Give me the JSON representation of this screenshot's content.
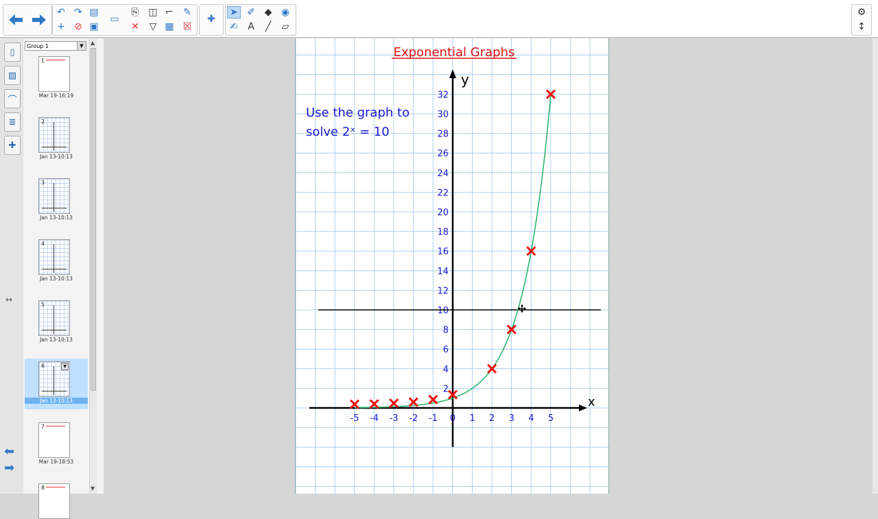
{
  "toolbar": {
    "nav": [
      {
        "icon": "arrow-left-icon"
      },
      {
        "icon": "arrow-right-icon"
      }
    ],
    "tools": [
      {
        "icon": "undo-icon",
        "glyph": "↶"
      },
      {
        "icon": "redo-icon",
        "glyph": "↷"
      },
      {
        "icon": "open-folder-icon",
        "glyph": "▤"
      },
      {
        "icon": "add-page-icon",
        "glyph": "+"
      },
      {
        "icon": "delete-page-icon",
        "glyph": "⊘"
      },
      {
        "icon": "save-icon",
        "glyph": "▣"
      },
      {
        "icon": "display-icon",
        "glyph": "▭"
      },
      {
        "icon": "paste-icon",
        "glyph": "⎘"
      },
      {
        "icon": "screen-capture-icon",
        "glyph": "◫"
      },
      {
        "icon": "screen-shade-icon",
        "glyph": "⌐"
      },
      {
        "icon": "magic-pen-icon",
        "glyph": "✎"
      },
      {
        "icon": "delete-icon",
        "glyph": "✕"
      },
      {
        "icon": "show-hide-icon",
        "glyph": "▽"
      },
      {
        "icon": "table-icon",
        "glyph": "▦"
      },
      {
        "icon": "close-box-icon",
        "glyph": "☒"
      },
      {
        "icon": "addon-puzzle-icon",
        "glyph": "✚"
      },
      {
        "icon": "select-arrow-icon",
        "glyph": "➤"
      },
      {
        "icon": "pen-icon",
        "glyph": "✐"
      },
      {
        "icon": "eraser-icon",
        "glyph": "◆"
      },
      {
        "icon": "fill-icon",
        "glyph": "◉"
      },
      {
        "icon": "pens-icon",
        "glyph": "✍"
      },
      {
        "icon": "text-icon",
        "glyph": "A"
      },
      {
        "icon": "line-icon",
        "glyph": "╱"
      },
      {
        "icon": "eraser-alt-icon",
        "glyph": "▱"
      }
    ],
    "right": [
      {
        "icon": "settings-gear-icon",
        "glyph": "⚙"
      },
      {
        "icon": "move-toolbar-icon",
        "glyph": "↕"
      }
    ]
  },
  "sidebar_tabs": [
    {
      "icon": "page-sorter-icon",
      "glyph": "▯"
    },
    {
      "icon": "gallery-icon",
      "glyph": "▨"
    },
    {
      "icon": "attachments-icon",
      "glyph": "⌒"
    },
    {
      "icon": "properties-icon",
      "glyph": "≣"
    },
    {
      "icon": "addons-icon",
      "glyph": "✚"
    }
  ],
  "sorter": {
    "group_label": "Group 1",
    "pages": [
      {
        "num": "1",
        "date": "Mar 19-16:19",
        "grid": false,
        "selected": false
      },
      {
        "num": "2",
        "date": "Jan 13-10:13",
        "grid": true,
        "selected": false
      },
      {
        "num": "3",
        "date": "Jan 13-10:13",
        "grid": true,
        "selected": false
      },
      {
        "num": "4",
        "date": "Jan 13-10:13",
        "grid": true,
        "selected": false
      },
      {
        "num": "5",
        "date": "Jan 13-10:13",
        "grid": true,
        "selected": false
      },
      {
        "num": "6",
        "date": "Jan 13-10:13",
        "grid": true,
        "selected": true
      },
      {
        "num": "7",
        "date": "Mar 19-18:53",
        "grid": false,
        "selected": false
      },
      {
        "num": "8",
        "date": "",
        "grid": false,
        "selected": false
      }
    ]
  },
  "colors": {
    "grid": "#9cc3ea",
    "title": "#e01010",
    "text": "#1a1ad0",
    "curve": "#2db56e",
    "marker": "#ee1111",
    "axis": "#000000"
  },
  "whiteboard": {
    "title": "Exponential Graphs",
    "instruction_line1": "Use the graph to",
    "instruction_line2": "solve 2ˣ = 10",
    "x_axis_label": "x",
    "y_axis_label": "y"
  },
  "chart_data": {
    "type": "line",
    "title": "Exponential Graphs",
    "xlabel": "x",
    "ylabel": "y",
    "xlim": [
      -5,
      5
    ],
    "ylim": [
      0,
      32
    ],
    "x_ticks": [
      "-5",
      "-4",
      "-3",
      "-2",
      "-1",
      "0",
      "1",
      "2",
      "3",
      "4",
      "5"
    ],
    "y_ticks": [
      "2",
      "4",
      "6",
      "8",
      "10",
      "12",
      "14",
      "16",
      "18",
      "20",
      "22",
      "24",
      "26",
      "28",
      "30",
      "32"
    ],
    "series": [
      {
        "kind": "curve",
        "x": [
          -5,
          -4,
          -3,
          -2,
          -1,
          0,
          1,
          2,
          3,
          4,
          5
        ],
        "values": [
          0.03,
          0.06,
          0.13,
          0.25,
          0.5,
          1,
          2,
          4,
          8,
          16,
          32
        ]
      },
      {
        "kind": "points",
        "x": [
          -5,
          -4,
          -3,
          -2,
          -1,
          0,
          2,
          3,
          4,
          5
        ],
        "values": [
          0.03,
          0.06,
          0.13,
          0.25,
          0.5,
          1,
          4,
          8,
          16,
          32
        ]
      }
    ],
    "reference_line_y": 10,
    "grid": true
  }
}
